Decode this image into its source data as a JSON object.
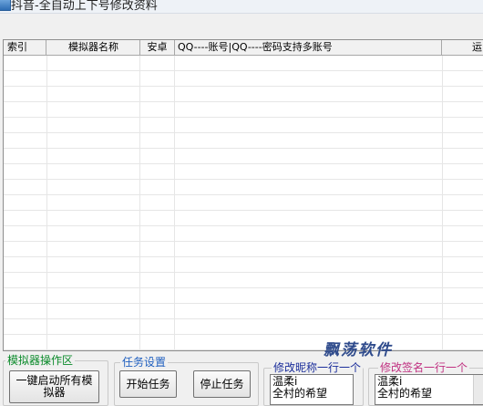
{
  "window": {
    "title": "抖音-全自动上下号修改资料"
  },
  "grid": {
    "columns": [
      "索引",
      "模拟器名称",
      "安卓",
      "QQ----账号|QQ----密码支持多账号",
      "运"
    ]
  },
  "watermark": "飘荡软件",
  "emulator_group": {
    "legend": "模拟器操作区",
    "start_all_button": "一键启动所有模拟器"
  },
  "task_group": {
    "legend": "任务设置",
    "start_button": "开始任务",
    "stop_button": "停止任务"
  },
  "nickname_group": {
    "legend": "修改昵称一行一个",
    "lines": [
      "温柔i",
      "全村的希望"
    ]
  },
  "signature_group": {
    "legend": "修改签名一行一个",
    "lines": [
      "温柔i",
      "全村的希望"
    ]
  },
  "colors": {
    "emulator_legend": "#0a8a2a",
    "task_legend": "#1f5fbf",
    "nickname_legend": "#1a2d9a",
    "signature_legend": "#c03080"
  }
}
